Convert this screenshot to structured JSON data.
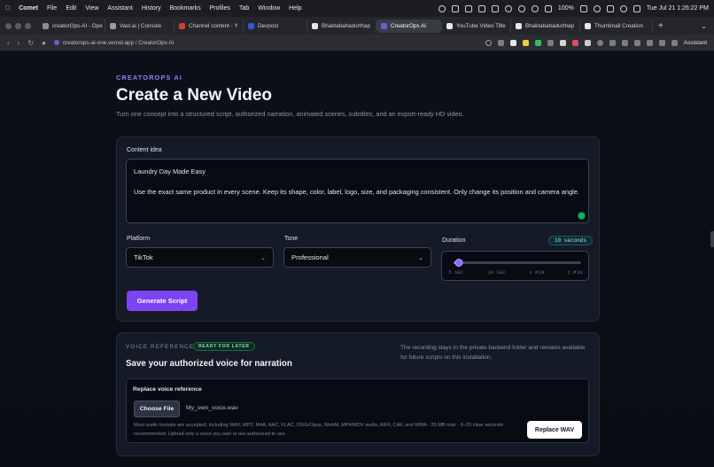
{
  "menubar": {
    "app": "Comet",
    "items": [
      "File",
      "Edit",
      "View",
      "Assistant",
      "History",
      "Bookmarks",
      "Profiles",
      "Tab",
      "Window",
      "Help"
    ],
    "battery": "100%",
    "clock": "Tue Jul 21  1:26:22 PM"
  },
  "tabs": [
    {
      "label": "creatorOps-AI - Ope",
      "color": "#8c8f96",
      "active": false
    },
    {
      "label": "Vast.ai | Console",
      "color": "#9a9da4",
      "active": false
    },
    {
      "label": "Channel content - Y",
      "color": "#e0382f",
      "active": false
    },
    {
      "label": "Devpost",
      "color": "#2f5ad1",
      "active": false
    },
    {
      "label": "Bhaktabahadurthap",
      "color": "#e8e8e8",
      "active": false
    },
    {
      "label": "CreatorOps AI",
      "color": "#6d5bd0",
      "active": true
    },
    {
      "label": "YouTube Video Title",
      "color": "#e8e8e8",
      "active": false
    },
    {
      "label": "Bhaktabahadurthap",
      "color": "#e8e8e8",
      "active": false
    },
    {
      "label": "Thumbnail Creation",
      "color": "#e8e8e8",
      "active": false
    }
  ],
  "addressbar": {
    "url": "creatorops-ai-one.vercel.app / CreatorOps AI",
    "assistant_label": "Assistant"
  },
  "header": {
    "eyebrow": "CREATOROPS AI",
    "title": "Create a New Video",
    "subtitle": "Turn one concept into a structured script, authorized narration, animated scenes, subtitles, and an export-ready HD video."
  },
  "form": {
    "content_label": "Content idea",
    "content_line1": "Laundry Day Made Easy",
    "content_line2": "Use the exact same product in every scene. Keep its shape, color, label, logo, size, and packaging consistent. Only change its position and camera angle.",
    "platform_label": "Platform",
    "platform_value": "TikTok",
    "tone_label": "Tone",
    "tone_value": "Professional",
    "duration_label": "Duration",
    "duration_badge": "10 seconds",
    "duration_ticks": [
      "5 SEC",
      "30 SEC",
      "1 MIN",
      "2 MIN"
    ],
    "duration_fraction": 0.04,
    "generate_label": "Generate Script"
  },
  "voice": {
    "section_label": "VOICE REFERENCE",
    "badge": "READY FOR LATER",
    "title": "Save your authorized voice for narration",
    "note": "The recording stays in the private backend folder and remains available for future scripts on this installation.",
    "replace_label": "Replace voice reference",
    "choose_file": "Choose File",
    "file_name": "My_own_voice.wav",
    "formats": "Most audio formats are accepted, including WAV, MP3, M4A, AAC, FLAC, OGG/Opus, WebM, MP4/MOV audio, AIFF, CAF, and WMA · 25 MB max · 6–20 clear seconds recommended. Upload only a voice you own or are authorized to use.",
    "replace_button": "Replace WAV"
  },
  "colors": {
    "accent": "#7d43f2",
    "eyebrow": "#9a7cf6",
    "background": "#0a0d14",
    "card": "#141a26"
  }
}
